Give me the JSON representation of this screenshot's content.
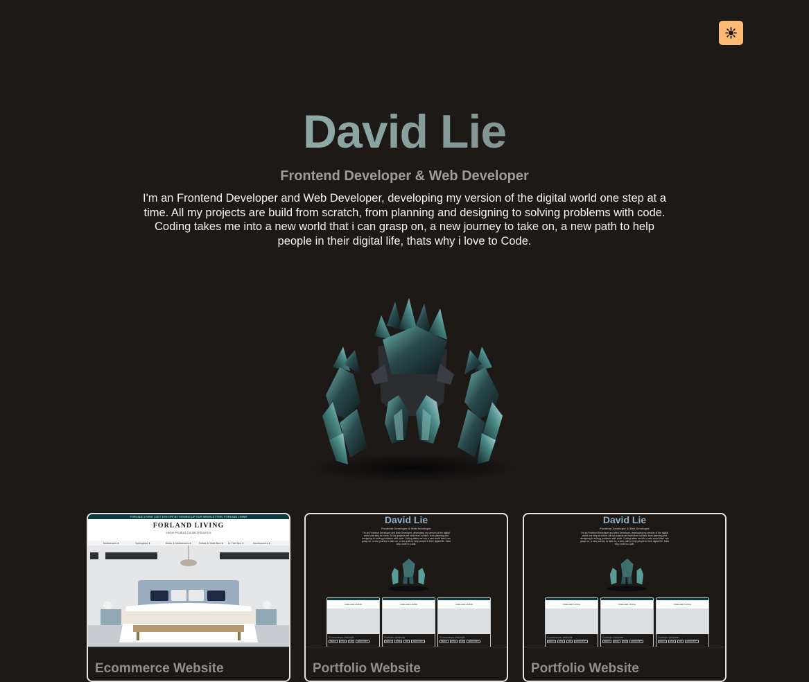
{
  "header": {
    "theme_toggle_icon": "sun-icon",
    "accent_color": "#fdba74"
  },
  "hero": {
    "name": "David Lie",
    "subtitle": "Frontend Developer & Web Developer",
    "bio": "I'm an Frontend Developer and Web Developer, developing my version of the digital world one step at a time. All my projects are build from scratch, from planning and designing to solving problems with code. Coding takes me into a new world that i can grasp on, a new journey to take on, a new path to help people in their digital life, thats why i love to Code.",
    "model_image": "crystal-golem-3d-model"
  },
  "projects": [
    {
      "title": "Ecommerce Website",
      "thumbnail": {
        "banner": "FORLAND LIVING | GET 10% OFF BY SIGNING UP OUR NEWSLETTER | FORLAND LIVING",
        "logo": "FORLAND LIVING",
        "nav": "Home   Product   Contact   About Us",
        "menu": [
          "Mattresses ▾",
          "Springbed ▾",
          "Beds & Mattresses ▾",
          "Sofas & Sofa Bed ▾",
          "In The Box ▾",
          "Accessories ▾"
        ]
      }
    },
    {
      "title": "Portfolio Website",
      "thumbnail": {
        "name": "David Lie",
        "subtitle": "Frontend Developer & Web Developer",
        "bio": "I'm an Frontend Developer and Web Developer, developing my version of the digital world one step at a time. All my projects are build from scratch, from planning and designing to solving problems with code. Coding takes me into a new world that i can grasp on, a new journey to take on, a new path to help people in their digital life, thats why i love to Code.",
        "mini_cards": [
          {
            "label": "Ecommerce Website",
            "tags": [
              "REACT",
              "HTML",
              "CSS",
              "JAVASCRIPT"
            ]
          },
          {
            "label": "Portfolio Website",
            "tags": [
              "REACT",
              "HTML",
              "CSS",
              "JAVASCRIPT"
            ]
          },
          {
            "label": "Ecommerce Website",
            "tags": [
              "REACT",
              "HTML",
              "CSS",
              "JAVASCRIPT"
            ]
          }
        ]
      }
    },
    {
      "title": "Portfolio Website",
      "thumbnail": {
        "name": "David Lie",
        "subtitle": "Frontend Developer & Web Developer",
        "bio": "I'm an Frontend Developer and Web Developer, developing my version of the digital world one step at a time. All my projects are build from scratch, from planning and designing to solving problems with code. Coding takes me into a new world that i can grasp on, a new journey to take on, a new path to help people in their digital life, thats why i love to Code.",
        "mini_cards": [
          {
            "label": "Ecommerce Website",
            "tags": [
              "REACT",
              "HTML",
              "CSS",
              "JAVASCRIPT"
            ]
          },
          {
            "label": "Portfolio Website",
            "tags": [
              "REACT",
              "HTML",
              "CSS",
              "JAVASCRIPT"
            ]
          },
          {
            "label": "Portfolio Website",
            "tags": [
              "REACT",
              "HTML",
              "CSS",
              "JAVASCRIPT"
            ]
          }
        ]
      }
    }
  ]
}
